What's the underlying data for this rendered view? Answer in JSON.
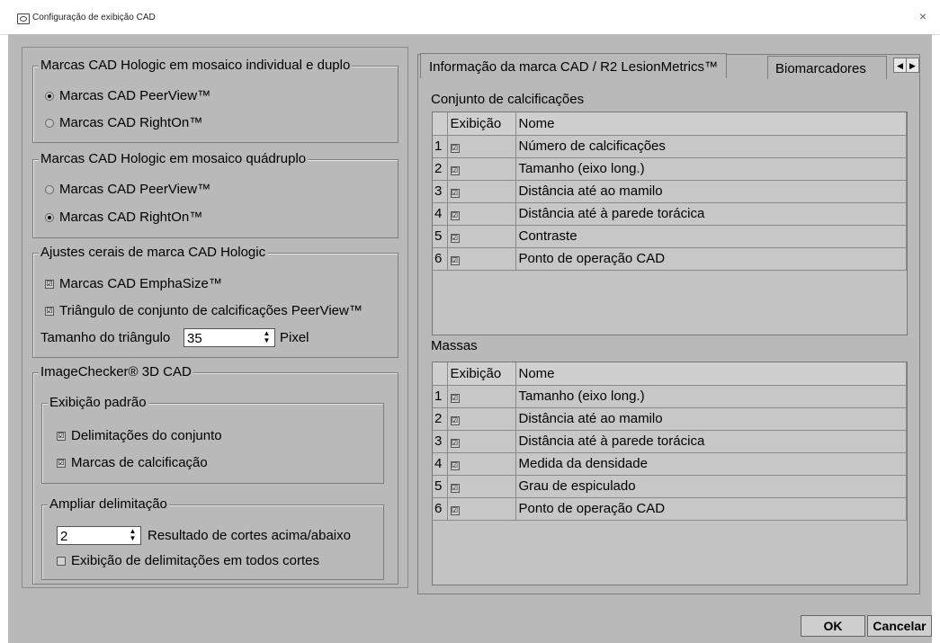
{
  "window": {
    "title": "Configuração de exibição CAD",
    "close_glyph": "×"
  },
  "group_single_dual": {
    "legend": "Marcas CAD Hologic em mosaico individual e duplo",
    "options": [
      {
        "label": "Marcas CAD PeerView™",
        "selected": true
      },
      {
        "label": "Marcas CAD RightOn™",
        "selected": false
      }
    ]
  },
  "group_quad": {
    "legend": "Marcas CAD Hologic em mosaico quádruplo",
    "options": [
      {
        "label": "Marcas CAD PeerView™",
        "selected": false
      },
      {
        "label": "Marcas CAD RightOn™",
        "selected": true
      }
    ]
  },
  "group_general": {
    "legend": "Ajustes cerais de marca CAD Hologic",
    "emphasize_label": "Marcas CAD EmphaSize™",
    "emphasize_checked": true,
    "triangle_label": "Triângulo de conjunto de calcificações PeerView™",
    "triangle_checked": true,
    "triangle_size_label": "Tamanho do triângulo",
    "triangle_size_value": "35",
    "triangle_size_unit": "Pixel"
  },
  "group_3d": {
    "legend": "ImageChecker® 3D CAD",
    "default_display": {
      "legend": "Exibição padrão",
      "cluster_outlines_label": "Delimitações do conjunto",
      "cluster_outlines_checked": true,
      "calc_marks_label": "Marcas de calcificação",
      "calc_marks_checked": true
    },
    "extend_outline": {
      "legend": "Ampliar delimitação",
      "slices_value": "2",
      "slices_label": "Resultado de cortes acima/abaixo",
      "all_slices_label": "Exibição de delimitações em todos cortes",
      "all_slices_checked": false
    }
  },
  "tabs": {
    "active": "Informação da marca CAD / R2 LesionMetrics™",
    "second": "Biomarcadores",
    "scroll_left": "◀",
    "scroll_right": "▶"
  },
  "calc_set": {
    "title": "Conjunto de calcificações",
    "col_display": "Exibição",
    "col_name": "Nome",
    "rows": [
      {
        "n": "1",
        "checked": true,
        "name": "Número de calcificações"
      },
      {
        "n": "2",
        "checked": true,
        "name": "Tamanho (eixo long.)"
      },
      {
        "n": "3",
        "checked": true,
        "name": "Distância até ao mamilo"
      },
      {
        "n": "4",
        "checked": true,
        "name": "Distância até à parede torácica"
      },
      {
        "n": "5",
        "checked": true,
        "name": "Contraste"
      },
      {
        "n": "6",
        "checked": true,
        "name": "Ponto de operação CAD"
      }
    ]
  },
  "masses": {
    "title": "Massas",
    "col_display": "Exibição",
    "col_name": "Nome",
    "rows": [
      {
        "n": "1",
        "checked": true,
        "name": "Tamanho (eixo long.)"
      },
      {
        "n": "2",
        "checked": true,
        "name": "Distância até ao mamilo"
      },
      {
        "n": "3",
        "checked": true,
        "name": "Distância até à parede torácica"
      },
      {
        "n": "4",
        "checked": true,
        "name": "Medida da densidade"
      },
      {
        "n": "5",
        "checked": true,
        "name": "Grau de espiculado"
      },
      {
        "n": "6",
        "checked": true,
        "name": "Ponto de operação CAD"
      }
    ]
  },
  "buttons": {
    "ok": "OK",
    "cancel": "Cancelar"
  },
  "glyphs": {
    "check": "☑",
    "spin_up": "▲",
    "spin_down": "▼"
  }
}
